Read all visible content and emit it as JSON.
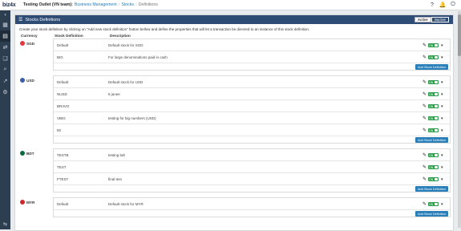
{
  "header": {
    "logo_text": "biz4x",
    "org": "Testing Outlet (VN team):",
    "breadcrumbs": [
      "Business Management",
      "Stocks",
      "Definitions"
    ],
    "icons": [
      "help-icon",
      "bell-icon",
      "power-icon"
    ]
  },
  "sidebar": {
    "icons": [
      "chevron-right-icon",
      "dashboard-icon",
      "document-icon",
      "transactions-icon",
      "layers-icon",
      "search-icon",
      "chart-icon",
      "gear-icon"
    ],
    "bottom_icon": "expand-icon"
  },
  "panel": {
    "title": "Stocks Definitions",
    "toggle_active": "Active",
    "toggle_inactive": "Inactive",
    "intro": "Create your stock definition by clicking on \"Add new stock definition\" button bellow and define the properties that will let a transaction be directed to an instance of this stock definition.",
    "columns": [
      "Currency",
      "Stock Definition",
      "Description"
    ],
    "add_label": "Add Stock Definition",
    "switch_label": "ON"
  },
  "groups": [
    {
      "currency": "SGD",
      "flag_color": "#e03a3e",
      "rows": [
        {
          "name": "Default",
          "desc": "Default stock for SGD"
        },
        {
          "name": "BIG",
          "desc": "For large denominations paid in cash"
        }
      ]
    },
    {
      "currency": "USD",
      "flag_color": "#3c5ea8",
      "rows": [
        {
          "name": "Default",
          "desc": "Default stock for USD"
        },
        {
          "name": "NUSD",
          "desc": "5 junee"
        },
        {
          "name": "BRAVO",
          "desc": ""
        },
        {
          "name": "VBIG",
          "desc": "testing for big numbers (USD)"
        },
        {
          "name": "50",
          "desc": ""
        }
      ]
    },
    {
      "currency": "BDT",
      "flag_color": "#0a6a3d",
      "rows": [
        {
          "name": "TESTB",
          "desc": "testing bdt"
        },
        {
          "name": "TEST",
          "desc": ""
        },
        {
          "name": "FTEST",
          "desc": "final test"
        }
      ]
    },
    {
      "currency": "MYR",
      "flag_color": "#cc2b2b",
      "rows": [
        {
          "name": "Default",
          "desc": "Default stock for MYR"
        }
      ]
    }
  ]
}
